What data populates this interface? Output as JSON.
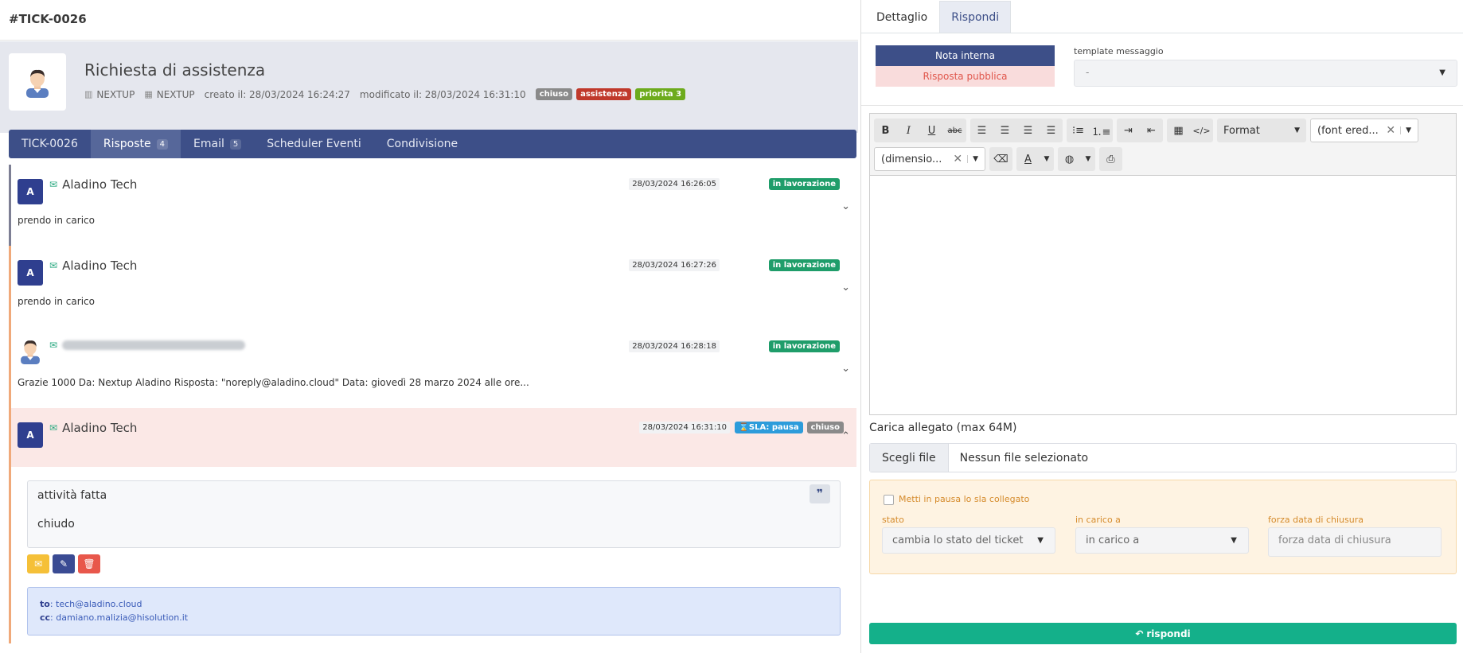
{
  "ticket_id": "#TICK-0026",
  "header": {
    "title": "Richiesta di assistenza",
    "company": "NEXTUP",
    "site": "NEXTUP",
    "created": "creato il: 28/03/2024 16:24:27",
    "modified": "modificato il: 28/03/2024 16:31:10",
    "badges": {
      "status": "chiuso",
      "category": "assistenza",
      "priority": "priorita 3"
    }
  },
  "tabs": [
    {
      "label": "TICK-0026",
      "count": ""
    },
    {
      "label": "Risposte",
      "count": "4"
    },
    {
      "label": "Email",
      "count": "5"
    },
    {
      "label": "Scheduler Eventi",
      "count": ""
    },
    {
      "label": "Condivisione",
      "count": ""
    }
  ],
  "replies": [
    {
      "avatar": "A",
      "author": "Aladino Tech",
      "date": "28/03/2024 16:26:05",
      "status": "in lavorazione",
      "text": "prendo in carico"
    },
    {
      "avatar": "A",
      "author": "Aladino Tech",
      "date": "28/03/2024 16:27:26",
      "status": "in lavorazione",
      "text": "prendo in carico"
    },
    {
      "avatar": "",
      "author": "",
      "date": "28/03/2024 16:28:18",
      "status": "in lavorazione",
      "text": "Grazie 1000 Da: Nextup Aladino Risposta: \"noreply@aladino.cloud\" Data: giovedì 28 marzo 2024 alle ore..."
    },
    {
      "avatar": "A",
      "author": "Aladino Tech",
      "date": "28/03/2024 16:31:10",
      "sla": "⌛SLA: pausa",
      "status": "chiuso",
      "body_line1": "attività fatta",
      "body_line2": "chiudo",
      "quote_icon": "❞",
      "to_label": "to",
      "to": "tech@aladino.cloud",
      "cc_label": "cc",
      "cc": "damiano.malizia@hisolution.it"
    }
  ],
  "right": {
    "tabs": [
      "Dettaglio",
      "Rispondi"
    ],
    "note_internal": "Nota interna",
    "note_public": "Risposta pubblica",
    "template_label": "template messaggio",
    "template_value": "-",
    "toolbar": {
      "format": "Format",
      "font": "(font ered...",
      "size": "(dimensio..."
    },
    "attach_label": "Carica allegato (max 64M)",
    "file_button": "Scegli file",
    "file_none": "Nessun file selezionato",
    "sla_pause": "Metti in pausa lo sla collegato",
    "stato_label": "stato",
    "stato_value": "cambia lo stato del ticket",
    "carico_label": "in carico a",
    "carico_value": "in carico a",
    "forza_label": "forza data di chiusura",
    "forza_placeholder": "forza data di chiusura",
    "submit": "rispondi"
  },
  "colors": {
    "primary": "#3d4f88",
    "success": "#14b08a",
    "danger": "#e8574b",
    "warning": "#f5c038"
  }
}
